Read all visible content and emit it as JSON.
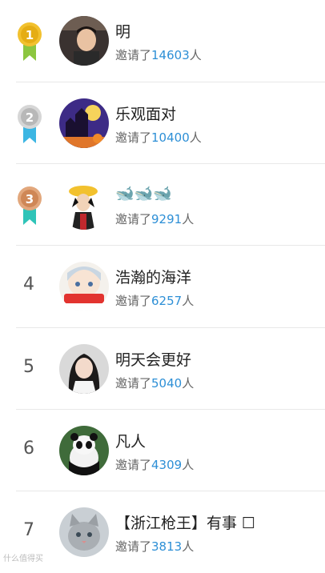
{
  "rows": [
    {
      "rank": "1",
      "medal": "gold",
      "name": "明",
      "prefix": "邀请了",
      "count": "14603",
      "suffix": "人",
      "avatar": "boy-photo"
    },
    {
      "rank": "2",
      "medal": "silver",
      "name": "乐观面对",
      "prefix": "邀请了",
      "count": "10400",
      "suffix": "人",
      "avatar": "halloween-castle"
    },
    {
      "rank": "3",
      "medal": "bronze",
      "name": "🐋🐋🐋",
      "prefix": "邀请了",
      "count": "9291",
      "suffix": "人",
      "avatar": "anime-pirate"
    },
    {
      "rank": "4",
      "medal": "",
      "name": "浩瀚的海洋",
      "prefix": "邀请了",
      "count": "6257",
      "suffix": "人",
      "avatar": "anime-girl-sign"
    },
    {
      "rank": "5",
      "medal": "",
      "name": "明天会更好",
      "prefix": "邀请了",
      "count": "5040",
      "suffix": "人",
      "avatar": "woman-photo"
    },
    {
      "rank": "6",
      "medal": "",
      "name": "凡人",
      "prefix": "邀请了",
      "count": "4309",
      "suffix": "人",
      "avatar": "panda-photo"
    },
    {
      "rank": "7",
      "medal": "",
      "name": "【浙江枪王】有事 ☐",
      "prefix": "邀请了",
      "count": "3813",
      "suffix": "人",
      "avatar": "cat-photo"
    }
  ],
  "watermark": "什么值得买",
  "colors": {
    "count": "#2d8fd6",
    "gold": "#f2c12e",
    "silver": "#c8c8c8",
    "bronze": "#d99a6c"
  }
}
